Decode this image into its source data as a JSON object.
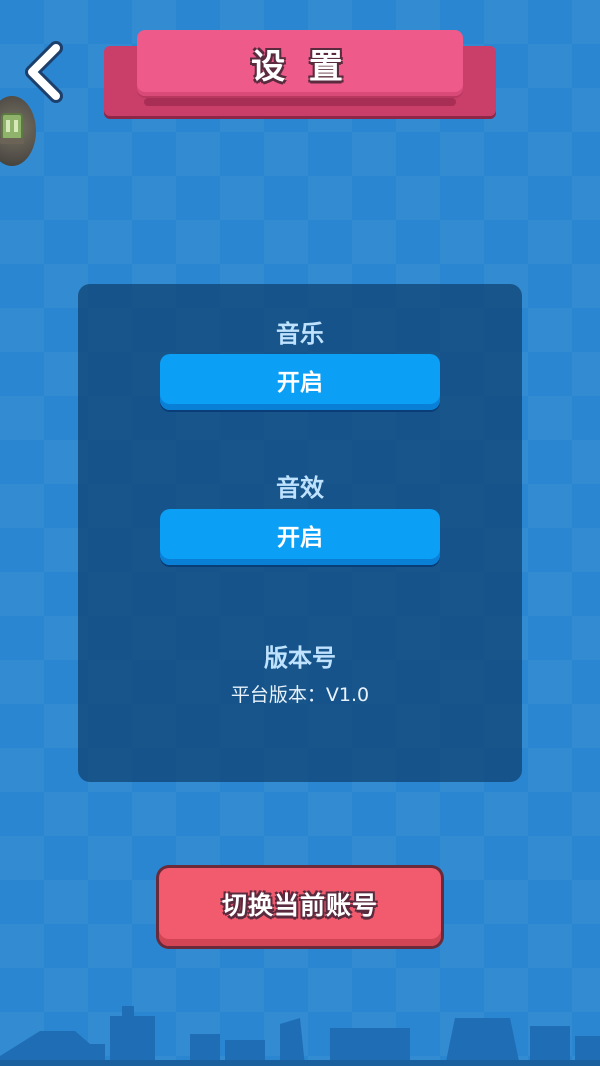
{
  "header": {
    "title": "设 置",
    "back_icon": "chevron-left-icon"
  },
  "avatar": {
    "icon": "avatar-icon"
  },
  "settings": {
    "music": {
      "label": "音乐",
      "value": "开启"
    },
    "sound_effects": {
      "label": "音效",
      "value": "开启"
    },
    "version": {
      "label": "版本号",
      "value": "平台版本：V1.0"
    }
  },
  "actions": {
    "switch_account_label": "切换当前账号"
  },
  "colors": {
    "background": "#2a86d0",
    "title_banner": "#ee5a8a",
    "toggle_button": "#0b9ff5",
    "switch_button": "#f25b6e",
    "panel_label": "#bfe3ff"
  }
}
